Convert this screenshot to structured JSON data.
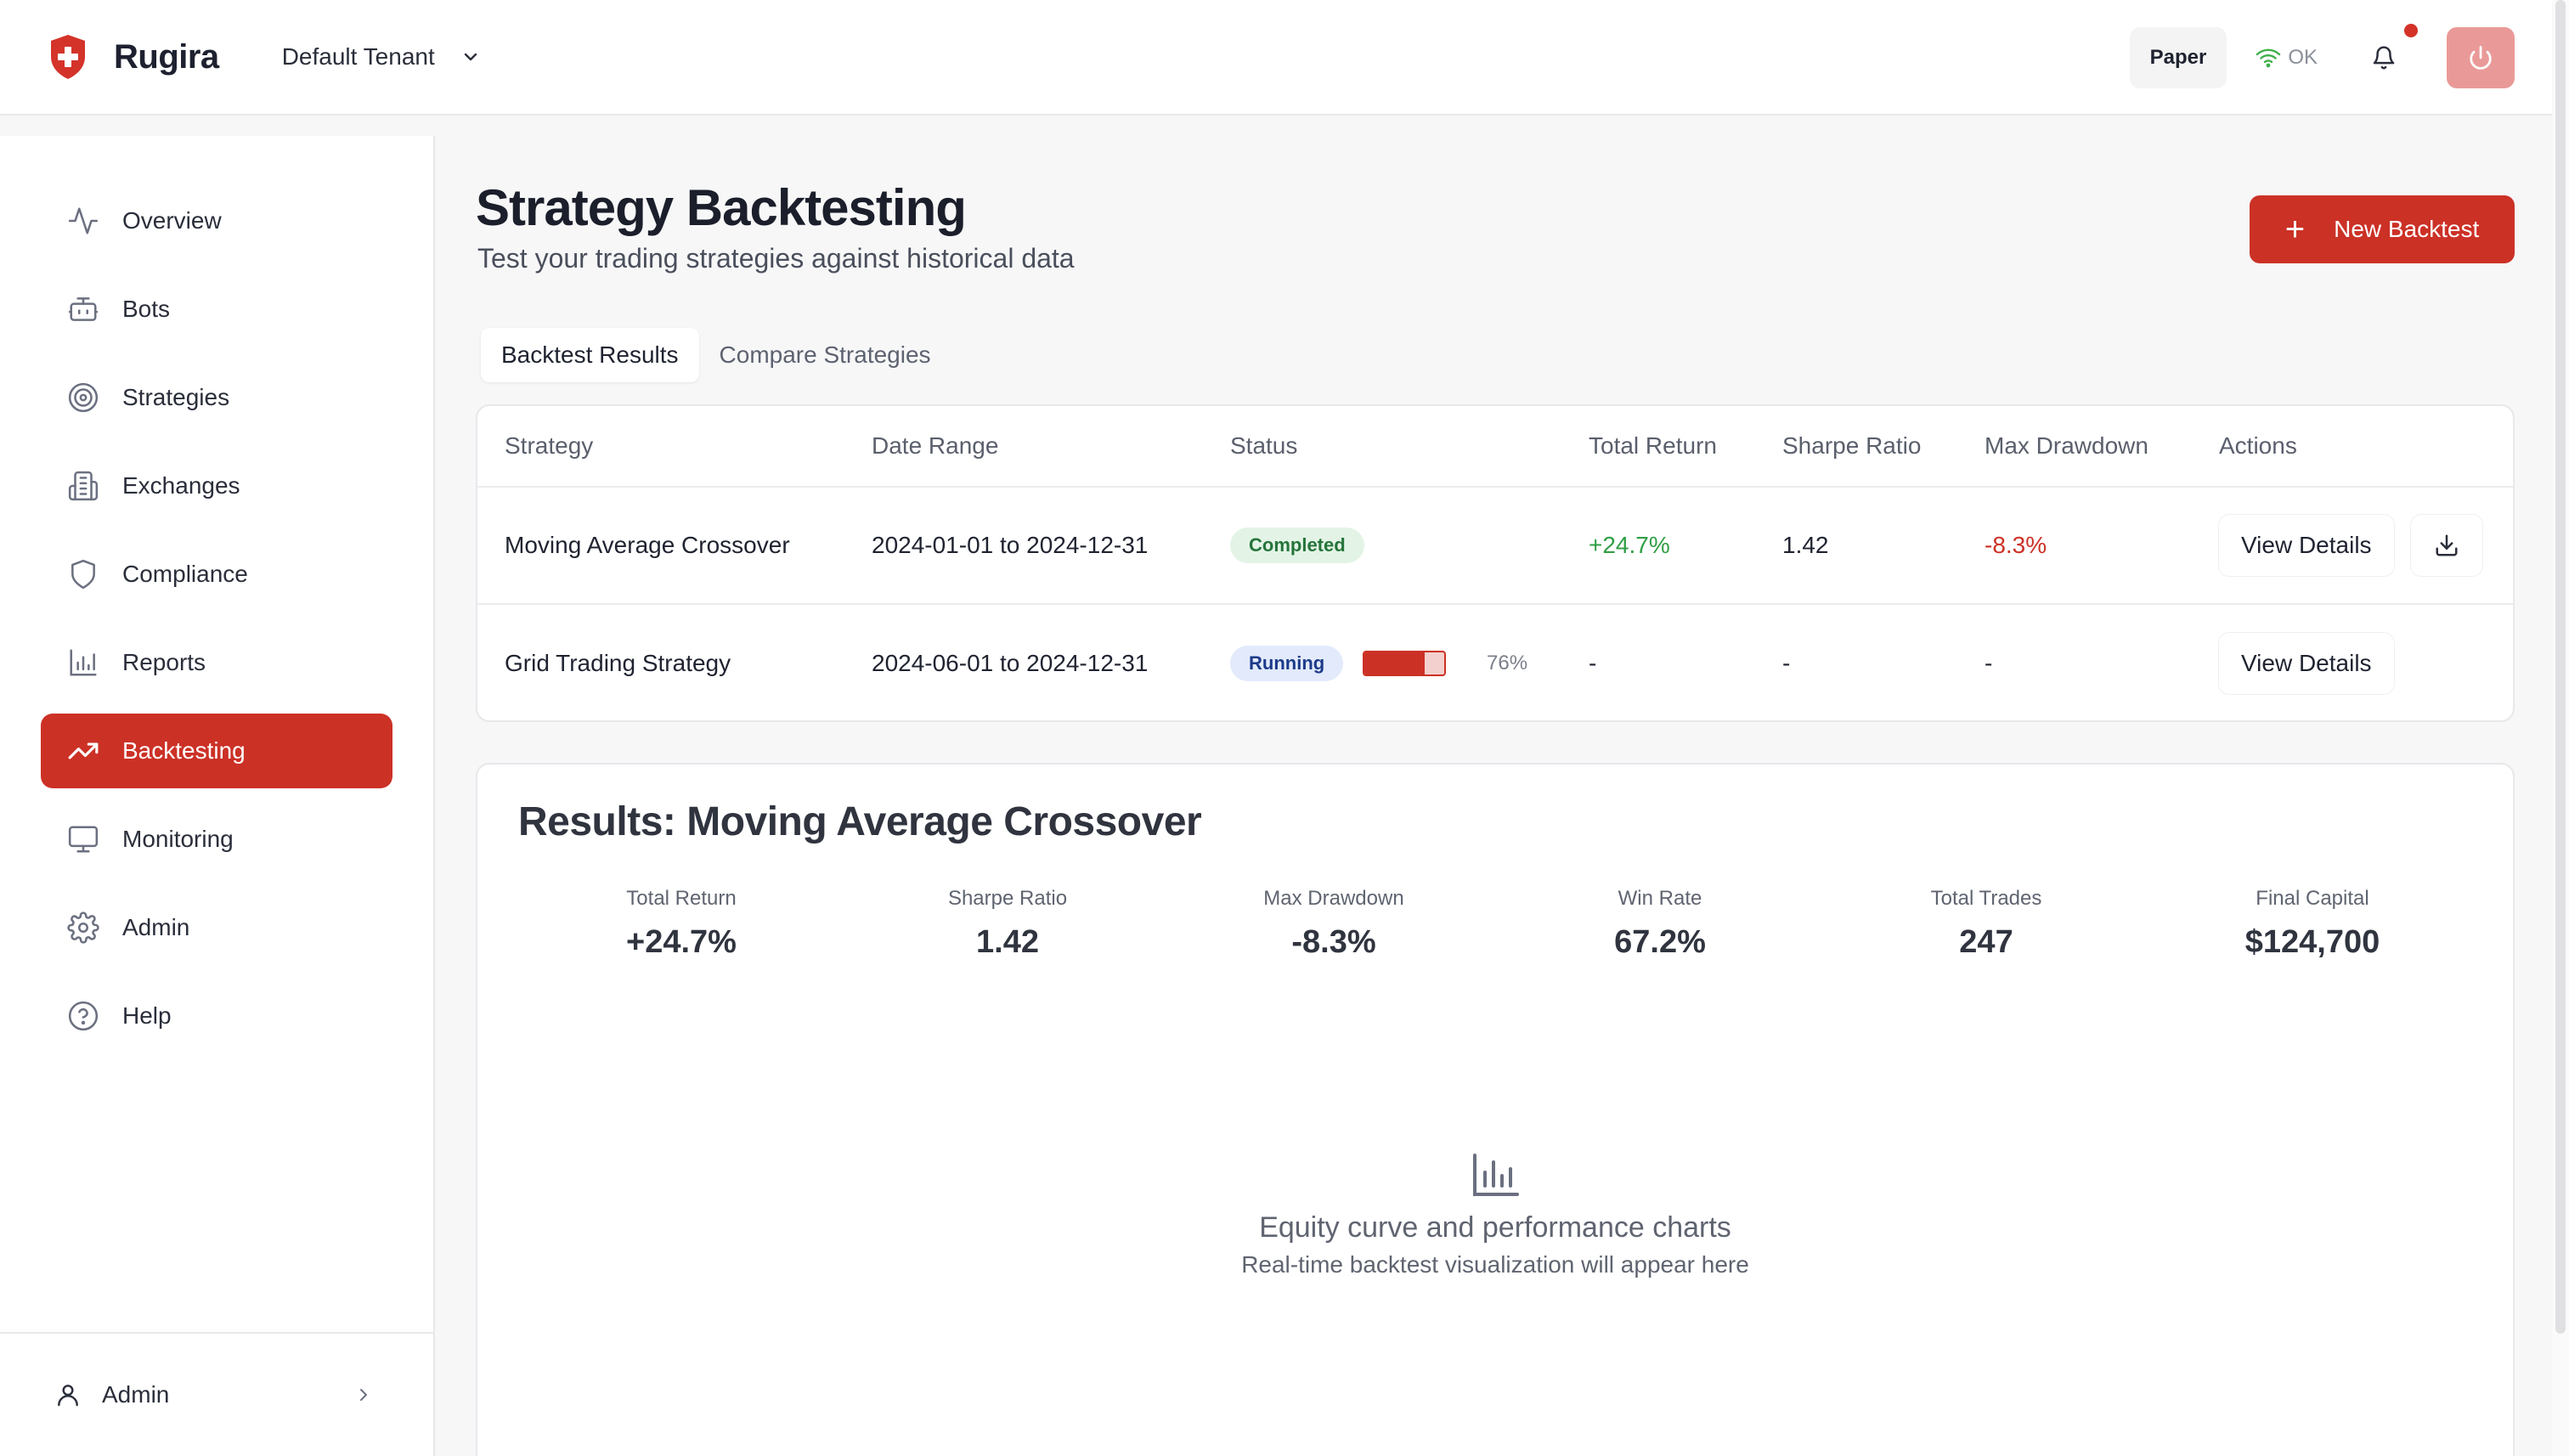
{
  "app": {
    "name": "Rugira",
    "brand_color": "#cc3126"
  },
  "header": {
    "tenant": "Default Tenant",
    "mode": "Paper",
    "connection": "OK",
    "has_notifications": true
  },
  "sidebar": {
    "items": [
      {
        "label": "Overview",
        "icon": "activity-icon",
        "active": false
      },
      {
        "label": "Bots",
        "icon": "bot-icon",
        "active": false
      },
      {
        "label": "Strategies",
        "icon": "target-icon",
        "active": false
      },
      {
        "label": "Exchanges",
        "icon": "building-icon",
        "active": false
      },
      {
        "label": "Compliance",
        "icon": "shield-icon",
        "active": false
      },
      {
        "label": "Reports",
        "icon": "bar-chart-icon",
        "active": false
      },
      {
        "label": "Backtesting",
        "icon": "trending-up-icon",
        "active": true
      },
      {
        "label": "Monitoring",
        "icon": "monitor-icon",
        "active": false
      },
      {
        "label": "Admin",
        "icon": "settings-icon",
        "active": false
      },
      {
        "label": "Help",
        "icon": "help-circle-icon",
        "active": false
      }
    ],
    "user": "Admin"
  },
  "page": {
    "title": "Strategy Backtesting",
    "subtitle": "Test your trading strategies against historical data",
    "new_button": "New Backtest"
  },
  "tabs": [
    {
      "label": "Backtest Results",
      "active": true
    },
    {
      "label": "Compare Strategies",
      "active": false
    }
  ],
  "table": {
    "columns": [
      "Strategy",
      "Date Range",
      "Status",
      "Total Return",
      "Sharpe Ratio",
      "Max Drawdown",
      "Actions"
    ],
    "rows": [
      {
        "strategy": "Moving Average Crossover",
        "date_range": "2024-01-01 to 2024-12-31",
        "status": "Completed",
        "total_return": "+24.7%",
        "sharpe": "1.42",
        "max_drawdown": "-8.3%",
        "action": "View Details"
      },
      {
        "strategy": "Grid Trading Strategy",
        "date_range": "2024-06-01 to 2024-12-31",
        "status": "Running",
        "progress": 76,
        "progress_label": "76%",
        "total_return": "-",
        "sharpe": "-",
        "max_drawdown": "-",
        "action": "View Details"
      }
    ]
  },
  "results": {
    "title": "Results: Moving Average Crossover",
    "metrics": [
      {
        "label": "Total Return",
        "value": "+24.7%",
        "tone": "positive"
      },
      {
        "label": "Sharpe Ratio",
        "value": "1.42",
        "tone": "neutral"
      },
      {
        "label": "Max Drawdown",
        "value": "-8.3%",
        "tone": "negative"
      },
      {
        "label": "Win Rate",
        "value": "67.2%",
        "tone": "neutral"
      },
      {
        "label": "Total Trades",
        "value": "247",
        "tone": "neutral"
      },
      {
        "label": "Final Capital",
        "value": "$124,700",
        "tone": "neutral"
      }
    ],
    "placeholder_title": "Equity curve and performance charts",
    "placeholder_subtitle": "Real-time backtest visualization will appear here"
  }
}
